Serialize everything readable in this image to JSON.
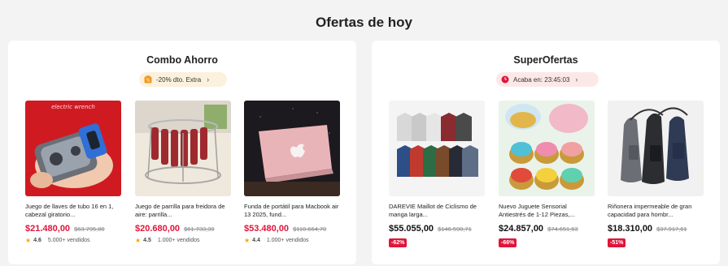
{
  "page_title": "Ofertas de hoy",
  "combo": {
    "title": "Combo Ahorro",
    "promo_label": "-20% dto. Extra",
    "promo_chevron": "›",
    "products": [
      {
        "name": "Juego de llaves de tubo 16 en 1, cabezal giratorio...",
        "price": "$21.480,00",
        "old_price": "$63.795,80",
        "rating": "4.6",
        "sold": "5.000+ vendidos",
        "thumb_text": "electric wrench"
      },
      {
        "name": "Juego de parrilla para freidora de aire: parrilla...",
        "price": "$20.680,00",
        "old_price": "$61.733,39",
        "rating": "4.5",
        "sold": "1.000+ vendidos"
      },
      {
        "name": "Funda de portátil para Macbook air 13 2025, fund...",
        "price": "$53.480,00",
        "old_price": "$110.664,70",
        "rating": "4.4",
        "sold": "1.000+ vendidos"
      }
    ]
  },
  "super": {
    "title": "SuperOfertas",
    "timer_label": "Acaba en: 23:45:03",
    "timer_chevron": "›",
    "products": [
      {
        "name": "DAREVIE Maillot de Ciclismo de manga larga...",
        "price": "$55.055,00",
        "old_price": "$146.590,71",
        "discount": "-62%"
      },
      {
        "name": "Nuevo Juguete Sensorial Antiestrés de 1-12 Piezas,...",
        "price": "$24.857,00",
        "old_price": "$74.651,63",
        "discount": "-66%"
      },
      {
        "name": "Riñonera impermeable de gran capacidad para hombr...",
        "price": "$18.310,00",
        "old_price": "$37.917,61",
        "discount": "-51%"
      }
    ]
  },
  "colors": {
    "accent_red": "#e0153a",
    "star": "#f6a800",
    "promo_bg": "#fbf1dc",
    "timer_bg": "#fde8e8"
  },
  "icons": {
    "promo": "coupon-icon",
    "timer": "clock-icon",
    "rating": "star-icon"
  }
}
